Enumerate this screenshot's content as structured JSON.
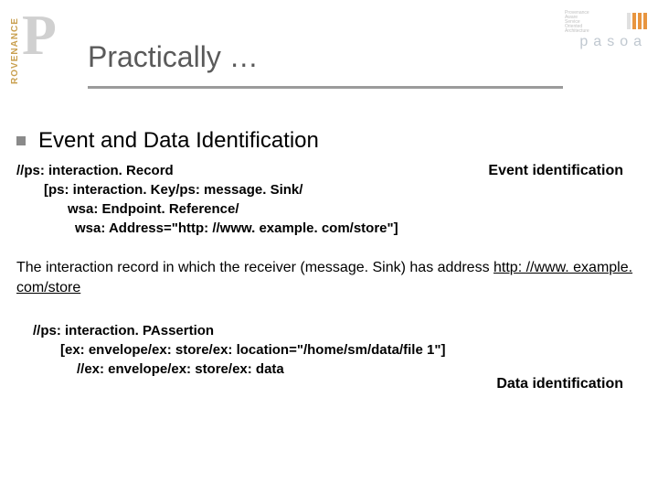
{
  "logo_left": {
    "rotated": "ROVENANCE",
    "letter": "P"
  },
  "logo_right": {
    "tiny": "Provenance\nAware\nService\nOriented\nArchitecture",
    "word": "pasoa"
  },
  "title": "Practically …",
  "section_title": "Event and Data Identification",
  "event_label": "Event identification",
  "code1": {
    "l1": "//ps: interaction. Record",
    "l2": "[ps: interaction. Key/ps: message. Sink/",
    "l3": "wsa: Endpoint. Reference/",
    "l4": "wsa: Address=\"http: //www. example. com/store\"]"
  },
  "description": {
    "text_a": "The interaction record in which the receiver (message. Sink) has address ",
    "url": "http: //www. example. com/store"
  },
  "code2": {
    "l1": "//ps: interaction. PAssertion",
    "l2": "[ex: envelope/ex: store/ex: location=\"/home/sm/data/file 1\"]",
    "l3": "//ex: envelope/ex: store/ex: data"
  },
  "data_label": "Data identification"
}
